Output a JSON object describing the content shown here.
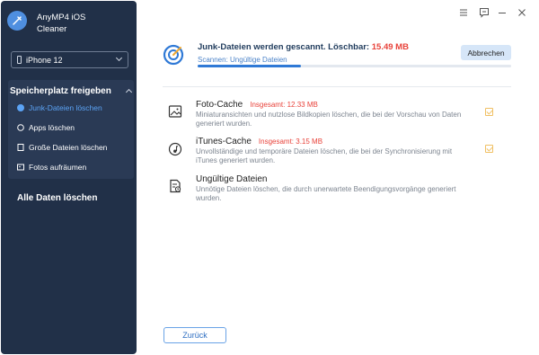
{
  "app": {
    "title": "AnyMP4 iOS Cleaner"
  },
  "device": {
    "selected": "iPhone 12"
  },
  "sidebar": {
    "section_title": "Speicherplatz freigeben",
    "items": [
      {
        "label": "Junk-Dateien löschen",
        "active": true
      },
      {
        "label": "Apps löschen"
      },
      {
        "label": "Große Dateien löschen"
      },
      {
        "label": "Fotos aufräumen"
      }
    ],
    "erase_all": "Alle Daten löschen"
  },
  "scan": {
    "title": "Junk-Dateien werden gescannt. Löschbar:",
    "size": "15.49 MB",
    "status": "Scannen: Ungültige Dateien",
    "progress": 0.33,
    "abort_label": "Abbrechen"
  },
  "items": [
    {
      "name": "Foto-Cache",
      "total": "Insgesamt: 12.33 MB",
      "desc": "Miniaturansichten und nutzlose Bildkopien löschen, die bei der Vorschau von Daten generiert wurden."
    },
    {
      "name": "iTunes-Cache",
      "total": "Insgesamt: 3.15 MB",
      "desc": "Unvollständige und temporäre Dateien löschen, die bei der Synchronisierung mit iTunes generiert wurden."
    },
    {
      "name": "Ungültige Dateien",
      "total": "",
      "desc": "Unnötige Dateien löschen, die durch unerwartete Beendigungsvorgänge generiert wurden."
    }
  ],
  "footer": {
    "back_label": "Zurück"
  },
  "colors": {
    "sidebar": "#213048",
    "accent": "#2f79d6",
    "danger": "#e8423a",
    "check": "#f0c064"
  }
}
